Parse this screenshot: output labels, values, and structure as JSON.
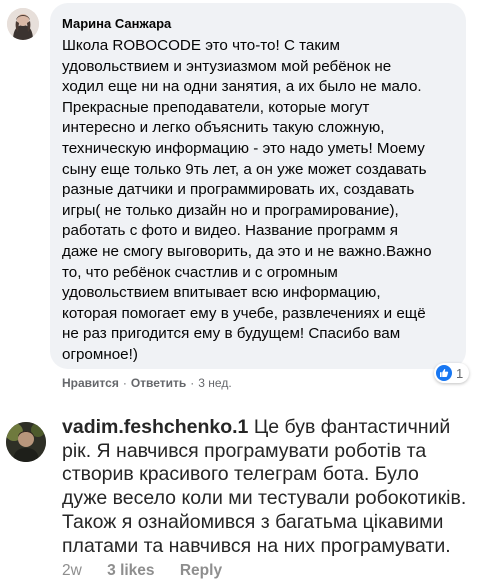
{
  "comment1": {
    "author": "Марина Санжара",
    "text_lines": [
      "Школа ROBOCODE это что-то! С таким",
      "удовольствием и энтузиазмом мой ребёнок не",
      "ходил еще ни на одни занятия, а их было не мало.",
      "Прекрасные преподаватели, которые могут",
      "интересно и легко объяснить такую сложную,",
      "техническую информацию - это надо уметь! Моему",
      "сыну еще только 9ть лет, а он уже может создавать",
      "разные датчики и программировать их, создавать",
      "игры( не только дизайн но и програмирование),",
      "работать с фото и видео. Название программ я",
      "даже не смогу выговорить, да это и не важно.Важно",
      "то, что ребёнок счастлив и с огромным",
      "удовольствием впитывает всю информацию,",
      "которая помогает ему в учебе, развлечениях и ещё",
      "не раз пригодится ему в будущем! Спасибо вам",
      "огромное!)"
    ],
    "like_label": "Нравится",
    "reply_label": "Ответить",
    "separator": "·",
    "time": "3 нед.",
    "reaction_count": "1",
    "reaction_icon": "thumbs-up-icon",
    "reaction_color": "#1877f2"
  },
  "comment2": {
    "username": "vadim.feshchenko.1",
    "text_first": "Це був фантастичний",
    "text_lines": [
      "рік. Я навчився програмувати роботів та",
      "створив красивого телеграм бота. Було",
      "дуже весело коли ми тестували робокотиків.",
      "Також я ознайомився з багатьма цікавими",
      "платами та навчився на них програмувати."
    ],
    "time": "2w",
    "likes": "3 likes",
    "reply_label": "Reply"
  }
}
